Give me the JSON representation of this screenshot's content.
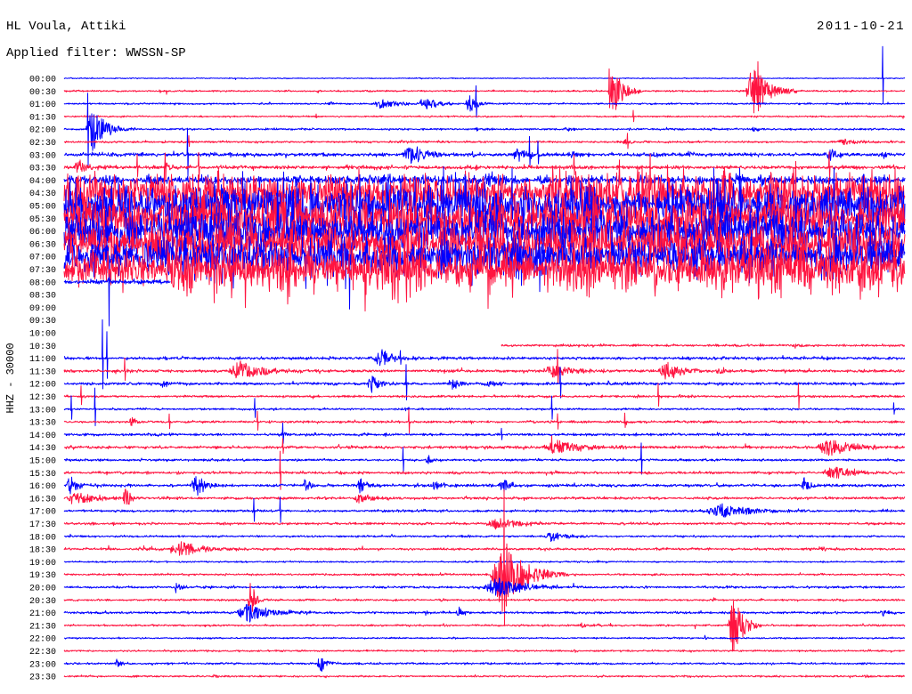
{
  "chart_data": {
    "type": "line",
    "title": "HL Voula, Attiki",
    "date": "2011-10-21",
    "subtitle": "Applied filter: WWSSN-SP",
    "ylabel": "HHZ - 30000",
    "xlabel": "",
    "grid": false,
    "colors": [
      "#0000ff",
      "#ff1440"
    ],
    "rows": [
      {
        "time": "00:00",
        "data_minutes": [
          0,
          30
        ],
        "noise": 500,
        "events": [],
        "spikes": [
          [
            29.2,
            75000
          ]
        ]
      },
      {
        "time": "00:30",
        "data_minutes": [
          0,
          30
        ],
        "noise": 900,
        "events": [
          [
            9.0,
            0.3,
            4000
          ],
          [
            19.4,
            1.3,
            50000
          ],
          [
            24.3,
            1.9,
            55000
          ]
        ],
        "spikes": [
          [
            19.45,
            60000
          ],
          [
            24.75,
            100000
          ]
        ]
      },
      {
        "time": "01:00",
        "data_minutes": [
          0,
          30
        ],
        "noise": 900,
        "events": [
          [
            9.4,
            0.6,
            6000
          ],
          [
            11.0,
            2.0,
            12000
          ],
          [
            12.6,
            1.8,
            14000
          ],
          [
            14.3,
            1.0,
            22000
          ]
        ],
        "spikes": [
          [
            14.7,
            45000
          ]
        ]
      },
      {
        "time": "01:30",
        "data_minutes": [
          0,
          30
        ],
        "noise": 800,
        "events": [],
        "spikes": [
          [
            20.3,
            14000
          ],
          [
            9.0,
            5000
          ]
        ]
      },
      {
        "time": "02:00",
        "data_minutes": [
          0,
          30
        ],
        "noise": 1000,
        "events": [
          [
            0.75,
            1.8,
            45000
          ],
          [
            14.6,
            0.5,
            5000
          ],
          [
            17.8,
            1.0,
            4000
          ],
          [
            24.5,
            0.6,
            6000
          ]
        ],
        "spikes": [
          [
            0.85,
            85000
          ]
        ]
      },
      {
        "time": "02:30",
        "data_minutes": [
          0,
          30
        ],
        "noise": 1000,
        "events": [
          [
            19.9,
            0.8,
            7000
          ],
          [
            27.4,
            2.6,
            6000
          ]
        ],
        "spikes": [
          [
            4.45,
            14000
          ],
          [
            20.1,
            16000
          ]
        ]
      },
      {
        "time": "03:00",
        "data_minutes": [
          0,
          30
        ],
        "noise": 1800,
        "events": [
          [
            12.0,
            2.4,
            20000
          ],
          [
            14.5,
            0.4,
            8000
          ],
          [
            16.0,
            1.3,
            15000
          ],
          [
            18.0,
            0.8,
            8000
          ],
          [
            22.2,
            0.6,
            8000
          ],
          [
            27.2,
            0.9,
            16000
          ],
          [
            29.1,
            0.5,
            8000
          ]
        ],
        "spikes": [
          [
            4.4,
            60000
          ],
          [
            16.6,
            40000
          ],
          [
            16.9,
            30000
          ]
        ]
      },
      {
        "time": "03:30",
        "data_minutes": [
          0,
          30
        ],
        "noise": 1800,
        "events": [
          [
            0.3,
            1.5,
            16000
          ],
          [
            3.5,
            1.0,
            8000
          ]
        ],
        "spikes": [
          [
            2.6,
            30000
          ],
          [
            3.6,
            40000
          ],
          [
            4.8,
            35000
          ],
          [
            18.2,
            30000
          ],
          [
            27.3,
            35000
          ]
        ]
      },
      {
        "time": "04:00",
        "data_minutes": [
          0,
          30
        ],
        "noise": 5000,
        "events": [],
        "spikes": []
      },
      {
        "time": "04:30",
        "data_minutes": [
          0,
          30
        ],
        "noise": 22000,
        "events": [],
        "spikes": []
      },
      {
        "time": "05:00",
        "data_minutes": [
          0,
          30
        ],
        "noise": 26000,
        "events": [],
        "spikes": []
      },
      {
        "time": "05:30",
        "data_minutes": [
          0,
          30
        ],
        "noise": 26000,
        "events": [],
        "spikes": []
      },
      {
        "time": "06:00",
        "data_minutes": [
          0,
          30
        ],
        "noise": 24000,
        "events": [],
        "spikes": []
      },
      {
        "time": "06:30",
        "data_minutes": [
          0,
          30
        ],
        "noise": 24000,
        "events": [],
        "spikes": []
      },
      {
        "time": "07:00",
        "data_minutes": [
          0,
          30
        ],
        "noise": 22000,
        "events": [],
        "spikes": []
      },
      {
        "time": "07:30",
        "data_minutes": [
          0,
          30
        ],
        "noise": 26000,
        "events": [],
        "spikes": []
      },
      {
        "time": "08:00",
        "data_minutes": [
          0,
          3.8
        ],
        "noise": 2500,
        "events": [],
        "spikes": []
      },
      {
        "time": "08:30",
        "data_minutes": null
      },
      {
        "time": "09:00",
        "data_minutes": null
      },
      {
        "time": "09:30",
        "data_minutes": null
      },
      {
        "time": "10:00",
        "data_minutes": null
      },
      {
        "time": "10:30",
        "data_minutes": [
          15.6,
          30
        ],
        "noise": 1200,
        "events": [
          [
            18.0,
            0.4,
            5000
          ],
          [
            26.0,
            0.5,
            4000
          ]
        ],
        "spikes": []
      },
      {
        "time": "11:00",
        "data_minutes": [
          0,
          30
        ],
        "noise": 1500,
        "events": [
          [
            11.0,
            2.0,
            18000
          ],
          [
            24.6,
            0.4,
            5000
          ],
          [
            3.5,
            0.4,
            5000
          ]
        ],
        "spikes": [
          [
            1.37,
            90000
          ],
          [
            1.52,
            60000
          ],
          [
            12.0,
            25000
          ]
        ]
      },
      {
        "time": "11:30",
        "data_minutes": [
          0,
          30
        ],
        "noise": 1500,
        "events": [
          [
            5.8,
            3.0,
            22000
          ],
          [
            17.0,
            3.0,
            13000
          ],
          [
            21.2,
            2.0,
            26000
          ],
          [
            23.2,
            1.0,
            8000
          ]
        ],
        "spikes": [
          [
            2.16,
            30000
          ],
          [
            17.6,
            50000
          ]
        ]
      },
      {
        "time": "12:00",
        "data_minutes": [
          0,
          30
        ],
        "noise": 1400,
        "events": [
          [
            3.4,
            0.8,
            9000
          ],
          [
            10.8,
            1.1,
            20000
          ],
          [
            13.7,
            0.9,
            20000
          ],
          [
            14.9,
            1.5,
            8000
          ],
          [
            19.3,
            0.8,
            6000
          ],
          [
            29.1,
            0.4,
            6000
          ]
        ],
        "spikes": [
          [
            12.2,
            45000
          ],
          [
            17.7,
            40000
          ]
        ]
      },
      {
        "time": "12:30",
        "data_minutes": [
          0,
          30
        ],
        "noise": 1200,
        "events": [],
        "spikes": [
          [
            21.2,
            30000
          ],
          [
            26.2,
            30000
          ],
          [
            0.6,
            25000
          ]
        ]
      },
      {
        "time": "13:00",
        "data_minutes": [
          0,
          30
        ],
        "noise": 1000,
        "events": [
          [
            12.0,
            0.5,
            5000
          ]
        ],
        "spikes": [
          [
            0.25,
            30000
          ],
          [
            1.1,
            50000
          ],
          [
            6.8,
            25000
          ],
          [
            17.4,
            30000
          ],
          [
            29.6,
            15000
          ]
        ]
      },
      {
        "time": "13:30",
        "data_minutes": [
          0,
          30
        ],
        "noise": 1200,
        "events": [
          [
            2.3,
            0.7,
            12000
          ]
        ],
        "spikes": [
          [
            3.75,
            20000
          ],
          [
            6.9,
            25000
          ],
          [
            12.3,
            30000
          ],
          [
            17.6,
            20000
          ],
          [
            20.0,
            20000
          ]
        ]
      },
      {
        "time": "14:00",
        "data_minutes": [
          0,
          30
        ],
        "noise": 1300,
        "events": [
          [
            7.8,
            0.4,
            8000
          ],
          [
            11.4,
            0.5,
            5000
          ]
        ],
        "spikes": [
          [
            7.8,
            30000
          ],
          [
            15.6,
            15000
          ]
        ]
      },
      {
        "time": "14:30",
        "data_minutes": [
          0,
          30
        ],
        "noise": 1500,
        "events": [
          [
            17.0,
            3.6,
            15000
          ],
          [
            26.8,
            3.2,
            18000
          ]
        ],
        "spikes": [
          [
            17.4,
            25000
          ],
          [
            7.8,
            20000
          ]
        ]
      },
      {
        "time": "15:00",
        "data_minutes": [
          0,
          30
        ],
        "noise": 1200,
        "events": [
          [
            12.9,
            0.6,
            9000
          ]
        ],
        "spikes": [
          [
            12.1,
            30000
          ],
          [
            20.6,
            40000
          ]
        ]
      },
      {
        "time": "15:30",
        "data_minutes": [
          0,
          30
        ],
        "noise": 1300,
        "events": [
          [
            27.0,
            3.0,
            14000
          ]
        ],
        "spikes": [
          [
            7.7,
            50000
          ]
        ]
      },
      {
        "time": "16:00",
        "data_minutes": [
          0,
          30
        ],
        "noise": 1500,
        "events": [
          [
            0.05,
            1.1,
            20000
          ],
          [
            4.5,
            1.3,
            24000
          ],
          [
            8.5,
            0.7,
            16000
          ],
          [
            10.4,
            1.0,
            16000
          ],
          [
            13.1,
            0.8,
            12000
          ],
          [
            15.5,
            0.9,
            20000
          ],
          [
            26.3,
            0.7,
            16000
          ]
        ],
        "spikes": []
      },
      {
        "time": "16:30",
        "data_minutes": [
          0,
          30
        ],
        "noise": 1300,
        "events": [
          [
            0.0,
            2.8,
            14000
          ],
          [
            2.1,
            0.6,
            28000
          ],
          [
            10.3,
            1.6,
            12000
          ]
        ],
        "spikes": []
      },
      {
        "time": "17:00",
        "data_minutes": [
          0,
          30
        ],
        "noise": 1200,
        "events": [
          [
            22.8,
            4.2,
            15000
          ]
        ],
        "spikes": [
          [
            6.77,
            30000
          ],
          [
            7.7,
            35000
          ]
        ]
      },
      {
        "time": "17:30",
        "data_minutes": [
          0,
          30
        ],
        "noise": 1200,
        "events": [
          [
            15.0,
            3.0,
            12000
          ],
          [
            1.7,
            0.4,
            4000
          ]
        ],
        "spikes": []
      },
      {
        "time": "18:00",
        "data_minutes": [
          0,
          30
        ],
        "noise": 1000,
        "events": [
          [
            17.1,
            2.2,
            12000
          ]
        ],
        "spikes": []
      },
      {
        "time": "18:30",
        "data_minutes": [
          0,
          30
        ],
        "noise": 1200,
        "events": [
          [
            3.7,
            3.2,
            16000
          ],
          [
            26.9,
            0.6,
            6000
          ]
        ],
        "spikes": []
      },
      {
        "time": "19:00",
        "data_minutes": [
          0,
          30
        ],
        "noise": 800,
        "events": [],
        "spikes": []
      },
      {
        "time": "19:30",
        "data_minutes": [
          0,
          30
        ],
        "noise": 1000,
        "events": [
          [
            15.2,
            2.8,
            80000
          ]
        ],
        "spikes": [
          [
            15.7,
            190000
          ]
        ]
      },
      {
        "time": "20:00",
        "data_minutes": [
          0,
          30
        ],
        "noise": 1200,
        "events": [
          [
            3.9,
            0.6,
            12000
          ],
          [
            14.9,
            3.5,
            20000
          ]
        ],
        "spikes": []
      },
      {
        "time": "20:30",
        "data_minutes": [
          0,
          30
        ],
        "noise": 1000,
        "events": [
          [
            6.55,
            0.6,
            50000
          ],
          [
            23.1,
            0.4,
            6000
          ]
        ],
        "spikes": []
      },
      {
        "time": "21:00",
        "data_minutes": [
          0,
          30
        ],
        "noise": 1200,
        "events": [
          [
            6.1,
            2.9,
            20000
          ],
          [
            14.0,
            0.6,
            12000
          ],
          [
            29.1,
            0.7,
            8000
          ]
        ],
        "spikes": []
      },
      {
        "time": "21:30",
        "data_minutes": [
          0,
          30
        ],
        "noise": 1000,
        "events": [
          [
            23.7,
            1.2,
            80000
          ],
          [
            18.4,
            0.5,
            8000
          ]
        ],
        "spikes": []
      },
      {
        "time": "22:00",
        "data_minutes": [
          0,
          30
        ],
        "noise": 800,
        "events": [
          [
            22.8,
            0.4,
            6000
          ]
        ],
        "spikes": []
      },
      {
        "time": "22:30",
        "data_minutes": [
          0,
          30
        ],
        "noise": 900,
        "events": [],
        "spikes": []
      },
      {
        "time": "23:00",
        "data_minutes": [
          0,
          30
        ],
        "noise": 1000,
        "events": [
          [
            1.8,
            0.5,
            12000
          ],
          [
            9.0,
            0.9,
            20000
          ]
        ],
        "spikes": []
      },
      {
        "time": "23:30",
        "data_minutes": [
          0,
          30
        ],
        "noise": 900,
        "events": [
          [
            5.3,
            0.4,
            6000
          ],
          [
            28.5,
            0.5,
            6000
          ]
        ],
        "spikes": []
      }
    ]
  }
}
